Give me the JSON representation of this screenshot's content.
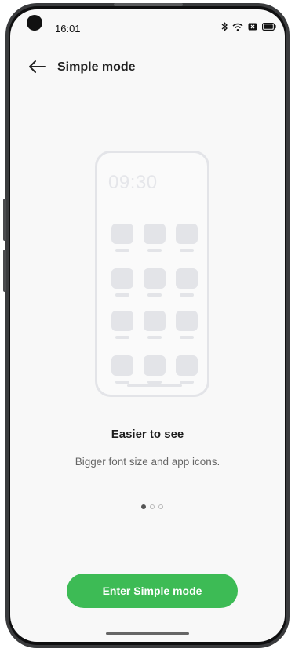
{
  "status_bar": {
    "time": "16:01"
  },
  "header": {
    "title": "Simple mode"
  },
  "illustration": {
    "clock": "09:30"
  },
  "feature": {
    "headline": "Easier to see",
    "description": "Bigger font size and app icons."
  },
  "pager": {
    "total": 3,
    "active_index": 0
  },
  "cta": {
    "label": "Enter Simple mode"
  },
  "colors": {
    "accent": "#3dbb55",
    "background": "#f8f8f8",
    "illustration": "#e3e4e8"
  }
}
